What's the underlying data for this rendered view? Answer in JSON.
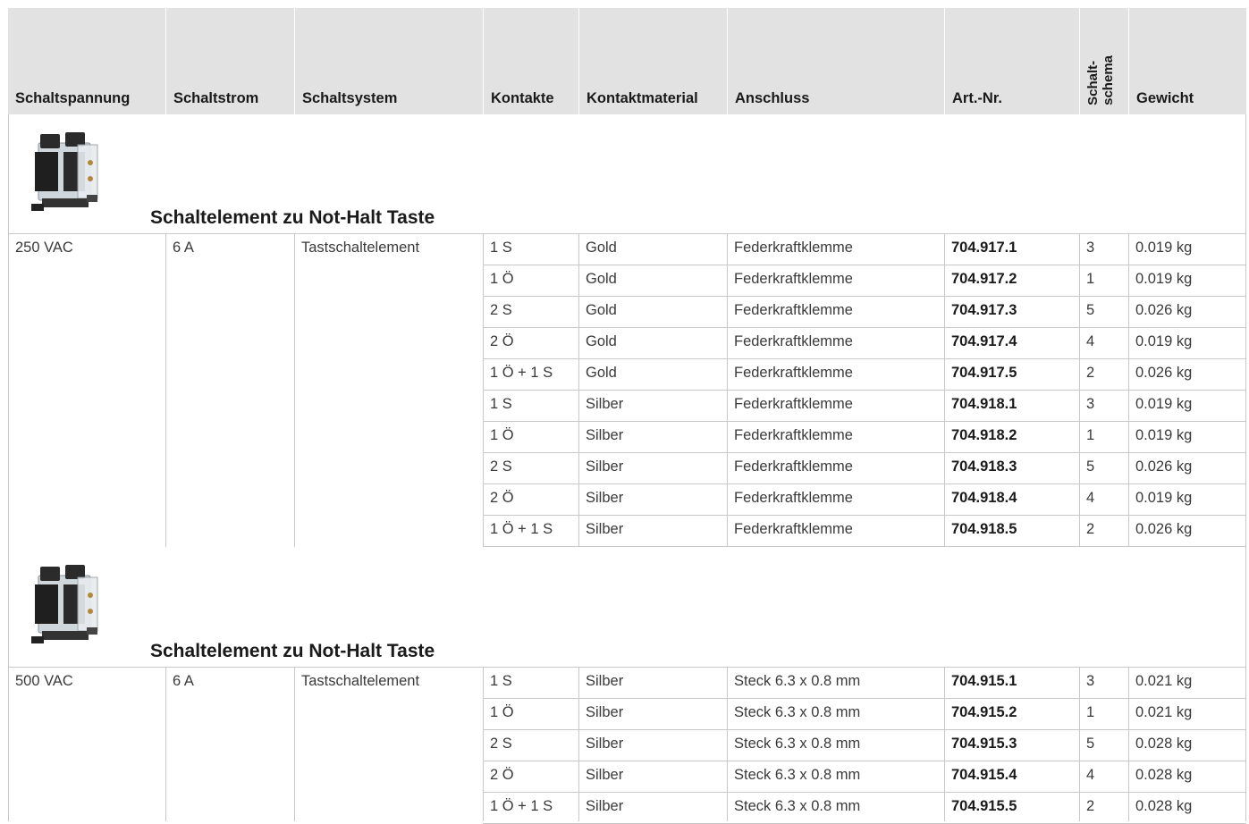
{
  "headers": [
    "Schaltspannung",
    "Schaltstrom",
    "Schaltsystem",
    "Kontakte",
    "Kontaktmaterial",
    "Anschluss",
    "Art.-Nr.",
    "Schalt-schema",
    "Gewicht"
  ],
  "rotated_header": [
    "Schalt-",
    "schema"
  ],
  "sections": [
    {
      "title": "Schaltelement zu Not-Halt Taste",
      "image_icon": "switching-element-product-image",
      "rows": [
        {
          "spannung": "250 VAC",
          "strom": "6 A",
          "system": "Tastschaltelement",
          "kontakte": "1 S",
          "material": "Gold",
          "anschluss": "Federkraftklemme",
          "artnr": "704.917.1",
          "schema": "3",
          "gewicht": "0.019 kg"
        },
        {
          "spannung": "",
          "strom": "",
          "system": "",
          "kontakte": "1 Ö",
          "material": "Gold",
          "anschluss": "Federkraftklemme",
          "artnr": "704.917.2",
          "schema": "1",
          "gewicht": "0.019 kg"
        },
        {
          "spannung": "",
          "strom": "",
          "system": "",
          "kontakte": "2 S",
          "material": "Gold",
          "anschluss": "Federkraftklemme",
          "artnr": "704.917.3",
          "schema": "5",
          "gewicht": "0.026 kg"
        },
        {
          "spannung": "",
          "strom": "",
          "system": "",
          "kontakte": "2 Ö",
          "material": "Gold",
          "anschluss": "Federkraftklemme",
          "artnr": "704.917.4",
          "schema": "4",
          "gewicht": "0.019 kg"
        },
        {
          "spannung": "",
          "strom": "",
          "system": "",
          "kontakte": "1 Ö + 1 S",
          "material": "Gold",
          "anschluss": "Federkraftklemme",
          "artnr": "704.917.5",
          "schema": "2",
          "gewicht": "0.026 kg"
        },
        {
          "spannung": "",
          "strom": "",
          "system": "",
          "kontakte": "1 S",
          "material": "Silber",
          "anschluss": "Federkraftklemme",
          "artnr": "704.918.1",
          "schema": "3",
          "gewicht": "0.019 kg"
        },
        {
          "spannung": "",
          "strom": "",
          "system": "",
          "kontakte": "1 Ö",
          "material": "Silber",
          "anschluss": "Federkraftklemme",
          "artnr": "704.918.2",
          "schema": "1",
          "gewicht": "0.019 kg"
        },
        {
          "spannung": "",
          "strom": "",
          "system": "",
          "kontakte": "2 S",
          "material": "Silber",
          "anschluss": "Federkraftklemme",
          "artnr": "704.918.3",
          "schema": "5",
          "gewicht": "0.026 kg"
        },
        {
          "spannung": "",
          "strom": "",
          "system": "",
          "kontakte": "2 Ö",
          "material": "Silber",
          "anschluss": "Federkraftklemme",
          "artnr": "704.918.4",
          "schema": "4",
          "gewicht": "0.019 kg"
        },
        {
          "spannung": "",
          "strom": "",
          "system": "",
          "kontakte": "1 Ö + 1 S",
          "material": "Silber",
          "anschluss": "Federkraftklemme",
          "artnr": "704.918.5",
          "schema": "2",
          "gewicht": "0.026 kg"
        }
      ]
    },
    {
      "title": "Schaltelement zu Not-Halt Taste",
      "image_icon": "switching-element-product-image",
      "rows": [
        {
          "spannung": "500 VAC",
          "strom": "6 A",
          "system": "Tastschaltelement",
          "kontakte": "1 S",
          "material": "Silber",
          "anschluss": "Steck 6.3 x 0.8 mm",
          "artnr": "704.915.1",
          "schema": "3",
          "gewicht": "0.021 kg"
        },
        {
          "spannung": "",
          "strom": "",
          "system": "",
          "kontakte": "1 Ö",
          "material": "Silber",
          "anschluss": "Steck 6.3 x 0.8 mm",
          "artnr": "704.915.2",
          "schema": "1",
          "gewicht": "0.021 kg"
        },
        {
          "spannung": "",
          "strom": "",
          "system": "",
          "kontakte": "2 S",
          "material": "Silber",
          "anschluss": "Steck 6.3 x 0.8 mm",
          "artnr": "704.915.3",
          "schema": "5",
          "gewicht": "0.028 kg"
        },
        {
          "spannung": "",
          "strom": "",
          "system": "",
          "kontakte": "2 Ö",
          "material": "Silber",
          "anschluss": "Steck 6.3 x 0.8 mm",
          "artnr": "704.915.4",
          "schema": "4",
          "gewicht": "0.028 kg"
        },
        {
          "spannung": "",
          "strom": "",
          "system": "",
          "kontakte": "1 Ö + 1 S",
          "material": "Silber",
          "anschluss": "Steck 6.3 x 0.8 mm",
          "artnr": "704.915.5",
          "schema": "2",
          "gewicht": "0.028 kg"
        }
      ]
    }
  ],
  "colors": {
    "header_bg": "#e2e2e2",
    "grid": "#c8c8c8",
    "text": "#3a3a3a"
  }
}
